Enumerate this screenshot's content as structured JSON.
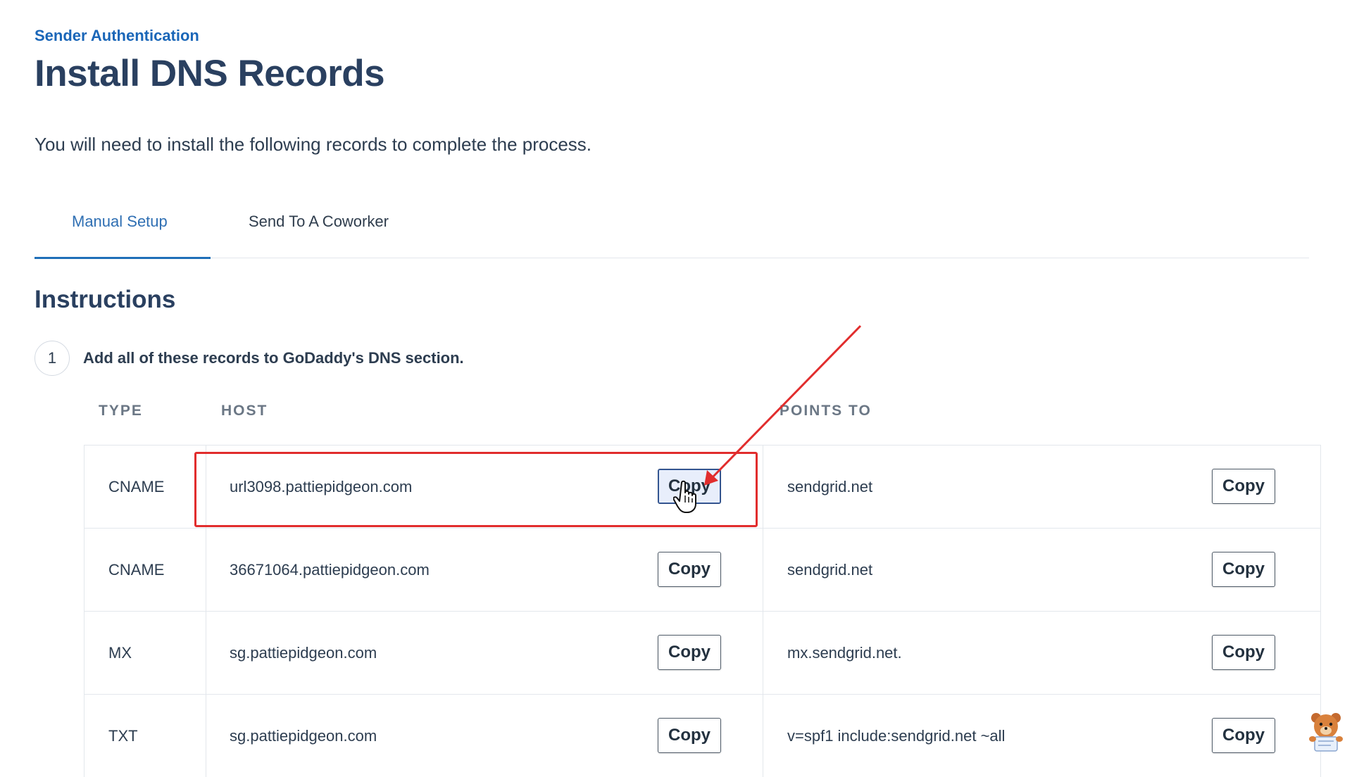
{
  "header": {
    "breadcrumb": "Sender Authentication",
    "title": "Install DNS Records",
    "subtitle": "You will need to install the following records to complete the process."
  },
  "tabs": [
    {
      "label": "Manual Setup",
      "active": true
    },
    {
      "label": "Send To A Coworker",
      "active": false
    }
  ],
  "instructions": {
    "title": "Instructions",
    "step_number": "1",
    "step_text": "Add all of these records to GoDaddy's DNS section."
  },
  "table": {
    "columns": {
      "type": "TYPE",
      "host": "HOST",
      "points_to": "POINTS TO"
    },
    "copy_label": "Copy",
    "rows": [
      {
        "type": "CNAME",
        "host": "url3098.pattiepidgeon.com",
        "points_to": "sendgrid.net"
      },
      {
        "type": "CNAME",
        "host": "36671064.pattiepidgeon.com",
        "points_to": "sendgrid.net"
      },
      {
        "type": "MX",
        "host": "sg.pattiepidgeon.com",
        "points_to": "mx.sendgrid.net."
      },
      {
        "type": "TXT",
        "host": "sg.pattiepidgeon.com",
        "points_to": "v=spf1 include:sendgrid.net ~all"
      }
    ]
  },
  "annotation": {
    "highlight_color": "#e12d2d",
    "arrow_color": "#e12d2d",
    "highlighted_row": 0
  },
  "colors": {
    "accent": "#1f6fb8",
    "heading": "#2a4060",
    "border": "#e3e7ec"
  },
  "icons": {
    "cursor": "hand-pointer-icon",
    "mascot": "bear-mascot-icon"
  }
}
